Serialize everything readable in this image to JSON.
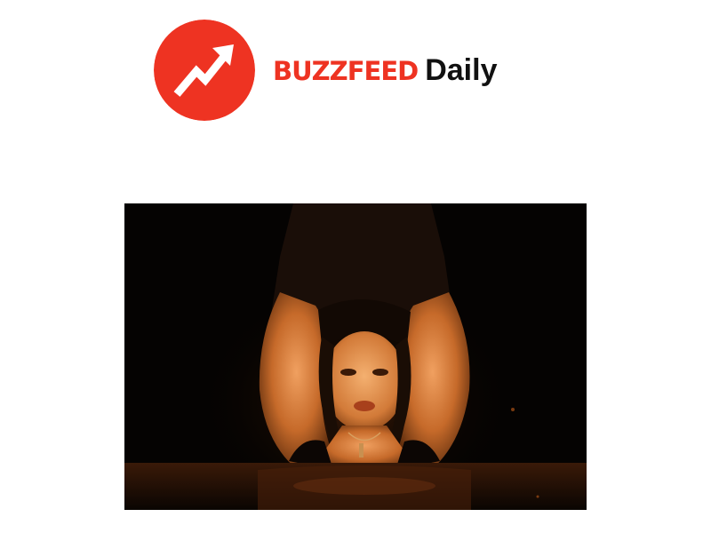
{
  "brand": {
    "name": "BuzzFeed",
    "suffix": "Daily",
    "accent_color": "#ee3322",
    "text_color": "#111111",
    "logo_icon": "trending-arrow-icon"
  },
  "hero_image": {
    "description_icon": "photo-icon"
  }
}
